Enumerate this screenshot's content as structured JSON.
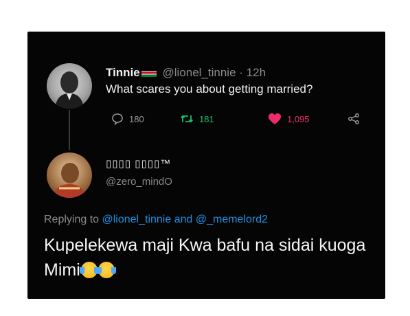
{
  "tweet1": {
    "name": "Tinnie",
    "handle": "@lionel_tinnie",
    "separator": "·",
    "time": "12h",
    "text": "What scares you about getting married?",
    "replies": "180",
    "retweets": "181",
    "likes": "1,095"
  },
  "tweet2": {
    "name": "▯▯▯▯ ▯▯▯▯™",
    "handle": "@zero_mindO",
    "replying_prefix": "Replying to",
    "replying_to_1": "@lionel_tinnie",
    "replying_and": "and",
    "replying_to_2": "@_memelord2",
    "text": "Kupelekewa maji Kwa bafu na sidai kuoga Mimi"
  },
  "icons": {
    "reply": "comment-bubble-icon",
    "retweet": "retweet-icon",
    "like": "heart-icon",
    "share": "share-icon",
    "emoji": "tears-of-joy-emoji"
  },
  "colors": {
    "background": "#050505",
    "link": "#1d8fe0",
    "retweet": "#19bf6a",
    "like": "#f02a6e"
  }
}
